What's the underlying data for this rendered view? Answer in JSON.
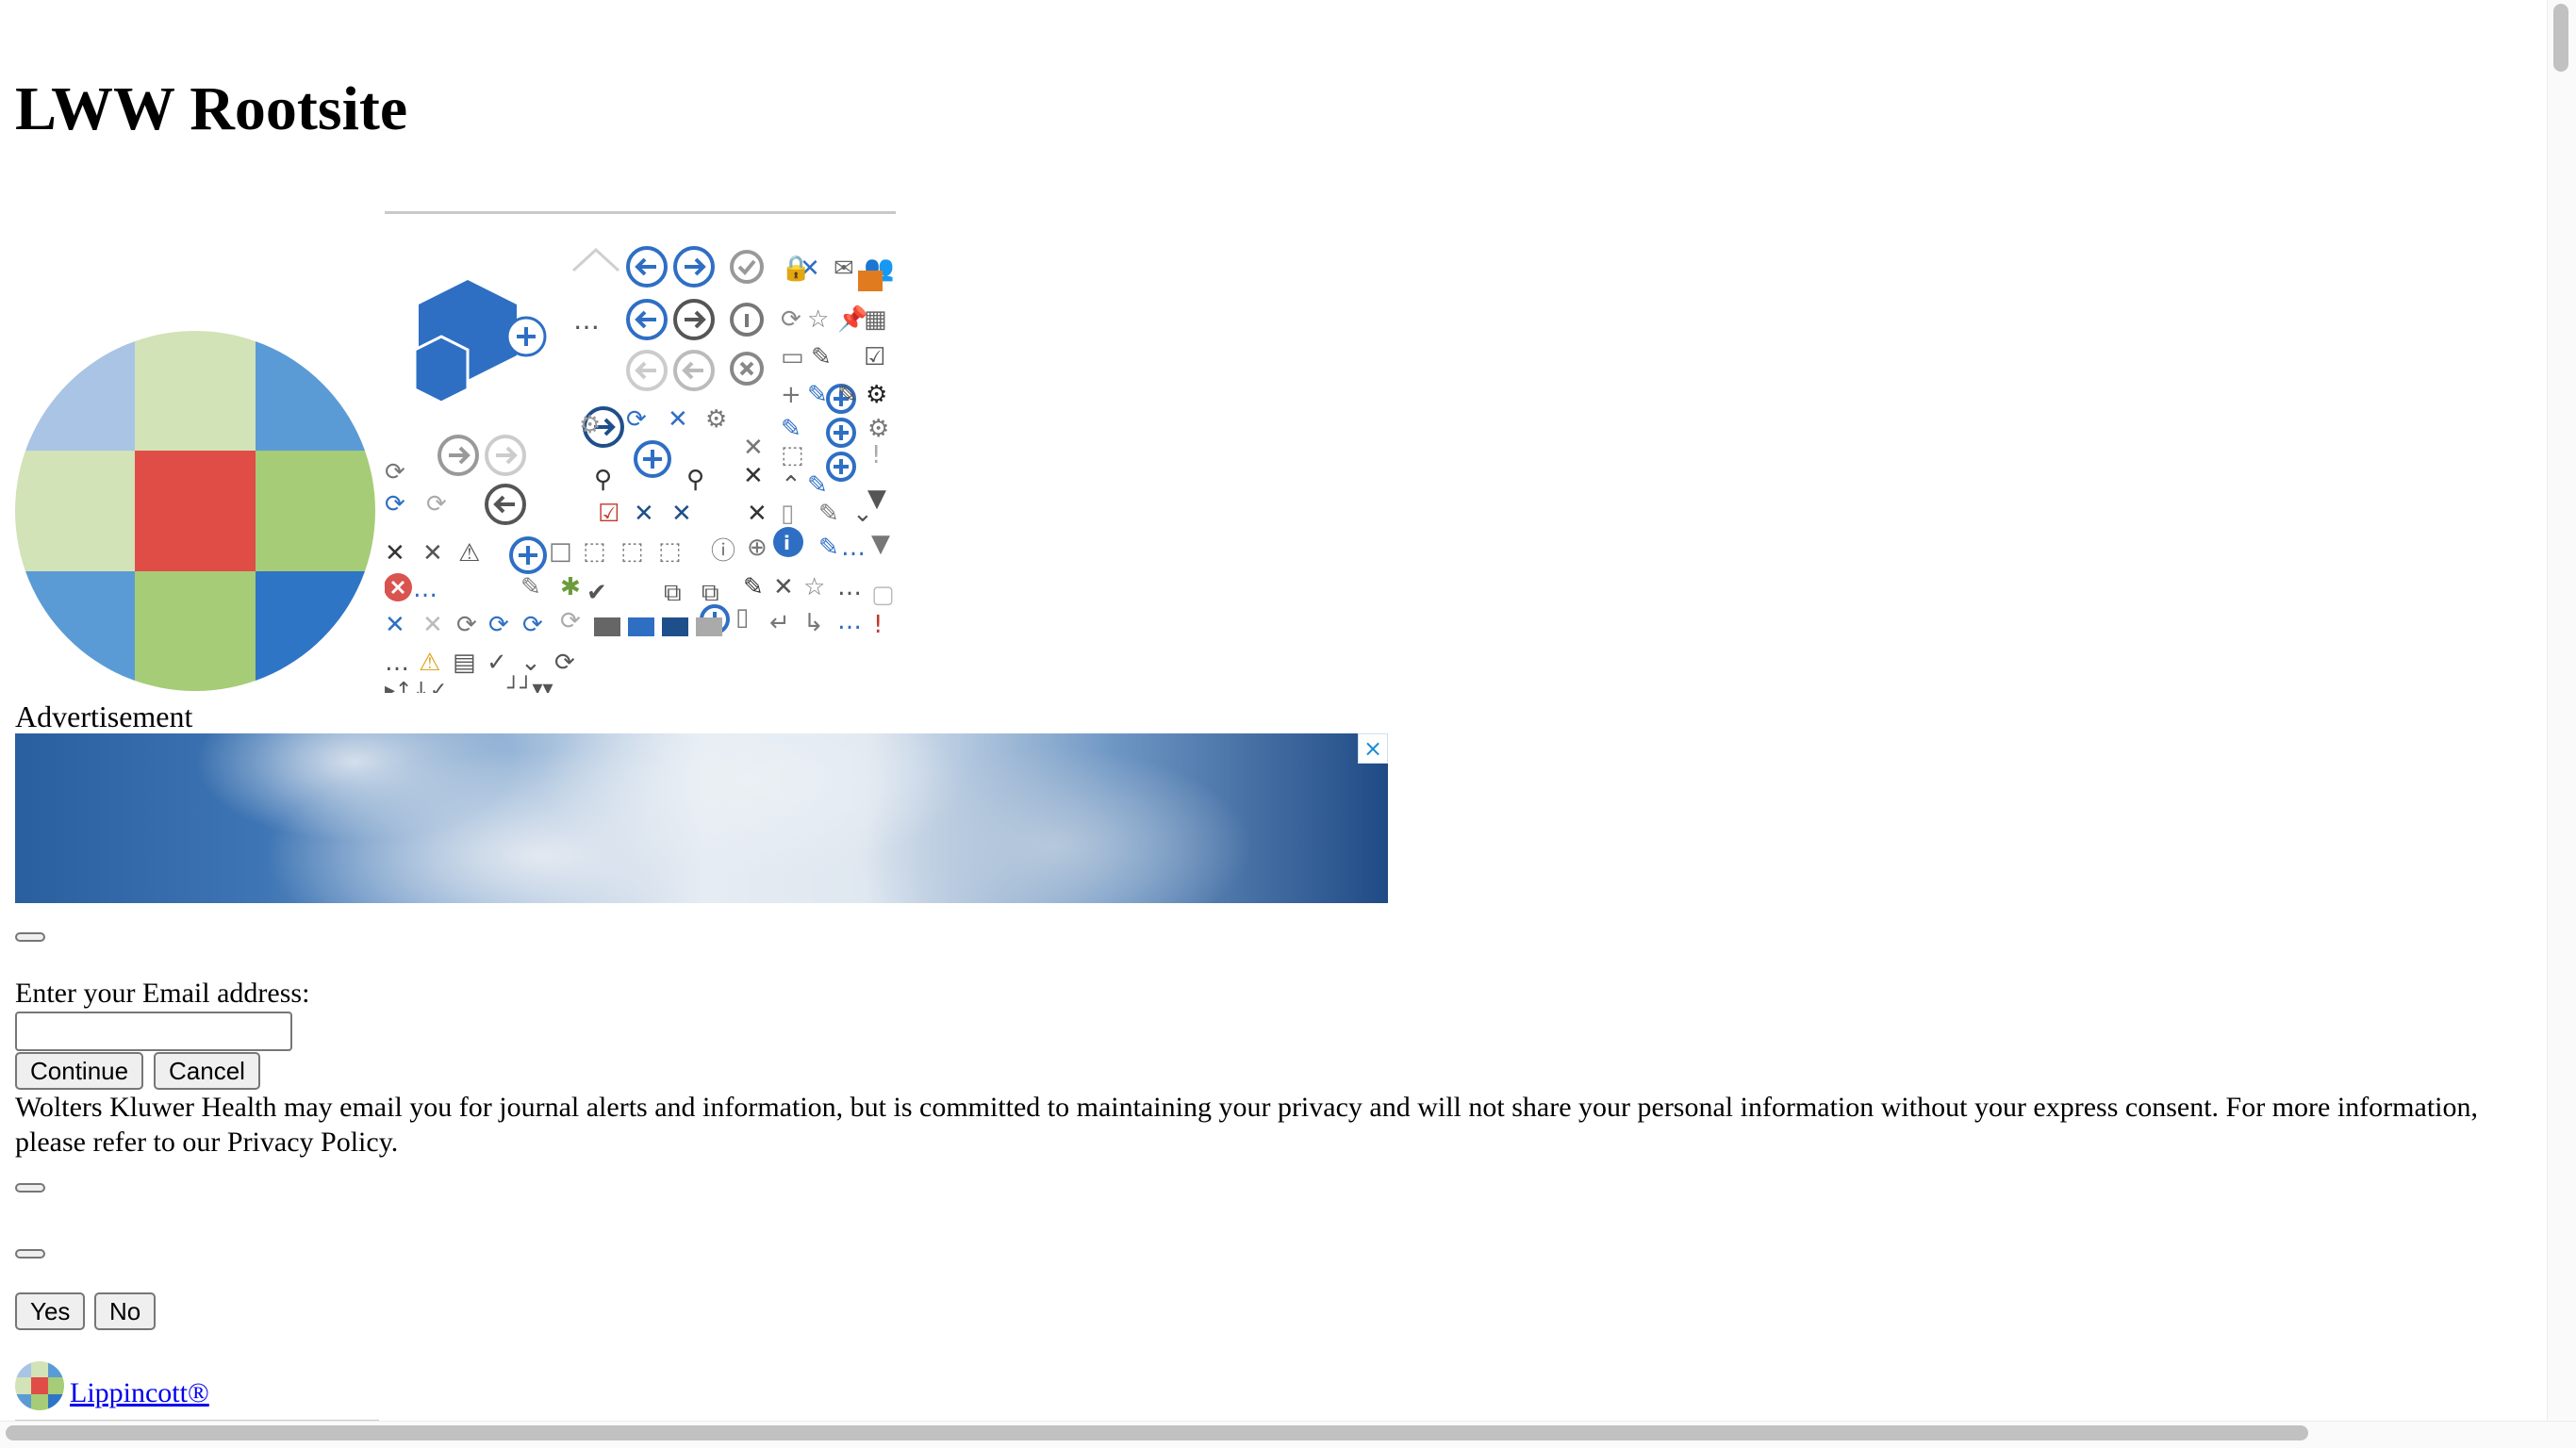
{
  "site": {
    "title": "LWW Rootsite"
  },
  "logo_colors": [
    "#a9c4e4",
    "#d1e3b7",
    "#5b9bd5",
    "#d1e3b7",
    "#e04d47",
    "#a6cc77",
    "#5b9bd5",
    "#a6cc77",
    "#2e75c6"
  ],
  "ad": {
    "label": "Advertisement",
    "close_icon": "×"
  },
  "email_form": {
    "label": "Enter your Email address:",
    "input_value": "",
    "continue_label": "Continue",
    "cancel_label": "Cancel"
  },
  "privacy_notice": "Wolters Kluwer Health may email you for journal alerts and information, but is committed to maintaining your privacy and will not share your personal information without your express consent. For more information, please refer to our Privacy Policy.",
  "confirm": {
    "yes_label": "Yes",
    "no_label": "No"
  },
  "footer": {
    "link_label": "Lippincott®"
  }
}
